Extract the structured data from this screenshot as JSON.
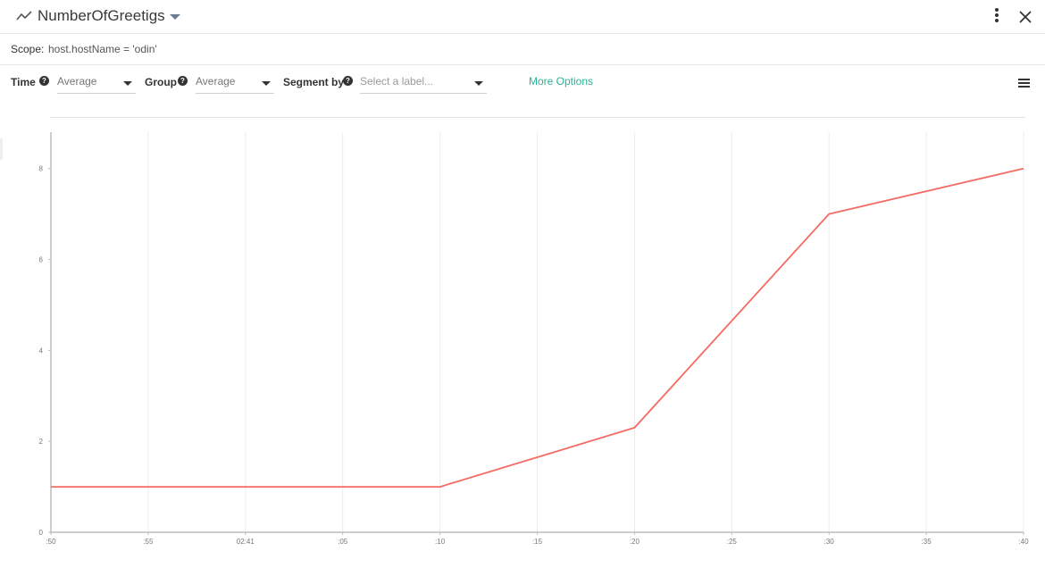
{
  "header": {
    "metric_icon": "trend-line-icon",
    "title": "NumberOfGreetigs",
    "menu_icon": "kebab-menu-icon",
    "close_icon": "close-icon"
  },
  "scope": {
    "label": "Scope:",
    "value": "host.hostName = 'odin'"
  },
  "controls": {
    "time_label": "Time",
    "time_value": "Average",
    "group_label": "Group",
    "group_value": "Average",
    "segment_label": "Segment by",
    "segment_placeholder": "Select a label...",
    "help_icon": "question-circle-icon",
    "more_options": "More Options",
    "legend_icon": "list-icon"
  },
  "chart_data": {
    "type": "line",
    "x_tick_labels": [
      ":50",
      ":55",
      "02:41",
      ":05",
      ":10",
      ":15",
      ":20",
      ":25",
      ":30",
      ":35",
      ":40"
    ],
    "y_tick_labels": [
      "0",
      "2",
      "4",
      "6",
      "8"
    ],
    "ylim": [
      0,
      8.8
    ],
    "series": [
      {
        "color": "#f36b63",
        "points": [
          {
            "x": ":50",
            "y": 1
          },
          {
            "x": ":10",
            "y": 1
          },
          {
            "x": ":20",
            "y": 2.3
          },
          {
            "x": ":30",
            "y": 7
          },
          {
            "x": ":40",
            "y": 8
          }
        ]
      }
    ],
    "grid_vertical": true,
    "grid_horizontal": false
  }
}
